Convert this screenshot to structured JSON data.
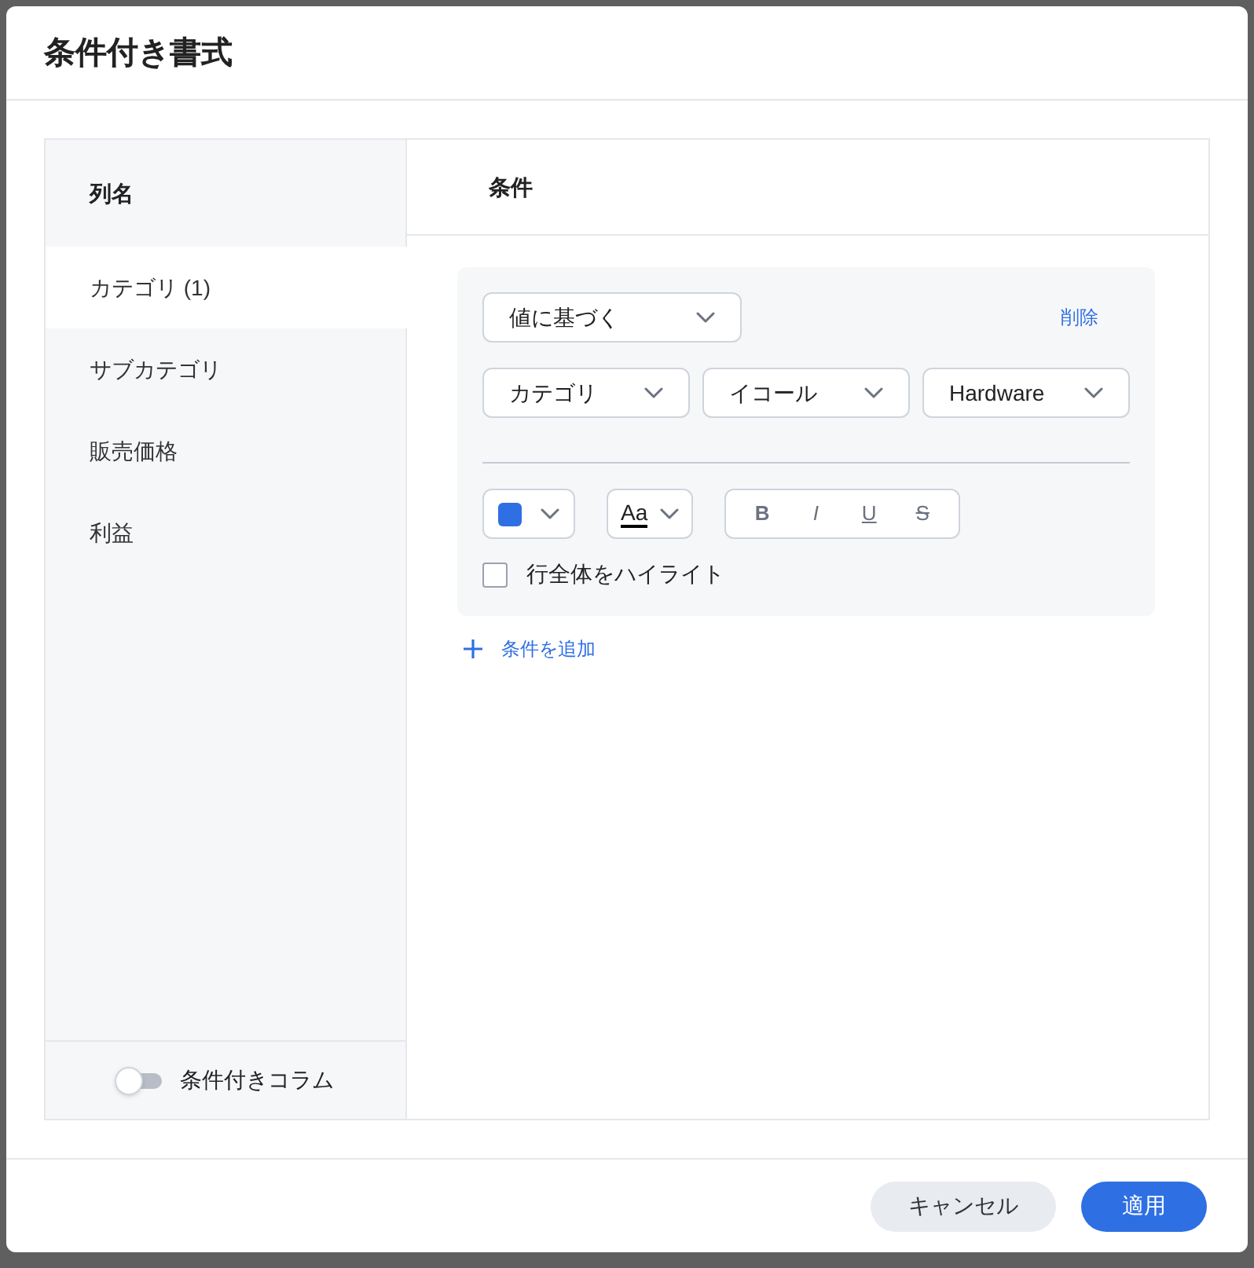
{
  "dialog": {
    "title": "条件付き書式"
  },
  "columns_panel": {
    "heading": "列名",
    "items": [
      {
        "label": "カテゴリ (1)",
        "selected": true
      },
      {
        "label": "サブカテゴリ",
        "selected": false
      },
      {
        "label": "販売価格",
        "selected": false
      },
      {
        "label": "利益",
        "selected": false
      }
    ],
    "toggle": {
      "label": "条件付きコラム",
      "on": false
    }
  },
  "conditions_panel": {
    "heading": "条件",
    "rule": {
      "type_select": "値に基づく",
      "delete_link": "削除",
      "selects": [
        "カテゴリ",
        "イコール",
        "Hardware"
      ],
      "fill_picker": {
        "color": "#2f6fe4"
      },
      "text_sample": "Aa",
      "styles": [
        {
          "kind": "bold",
          "label": "B",
          "on": false
        },
        {
          "kind": "italic",
          "label": "I",
          "on": false
        },
        {
          "kind": "underline",
          "label": "U",
          "on": false
        },
        {
          "kind": "strike",
          "label": "S",
          "on": false
        }
      ],
      "highlight_row": {
        "label": "行全体をハイライト",
        "checked": false
      }
    },
    "add_link": "条件を追加"
  },
  "buttons": [
    {
      "label": "キャンセル",
      "kind": "secondary"
    },
    {
      "label": "適用",
      "kind": "primary"
    }
  ]
}
